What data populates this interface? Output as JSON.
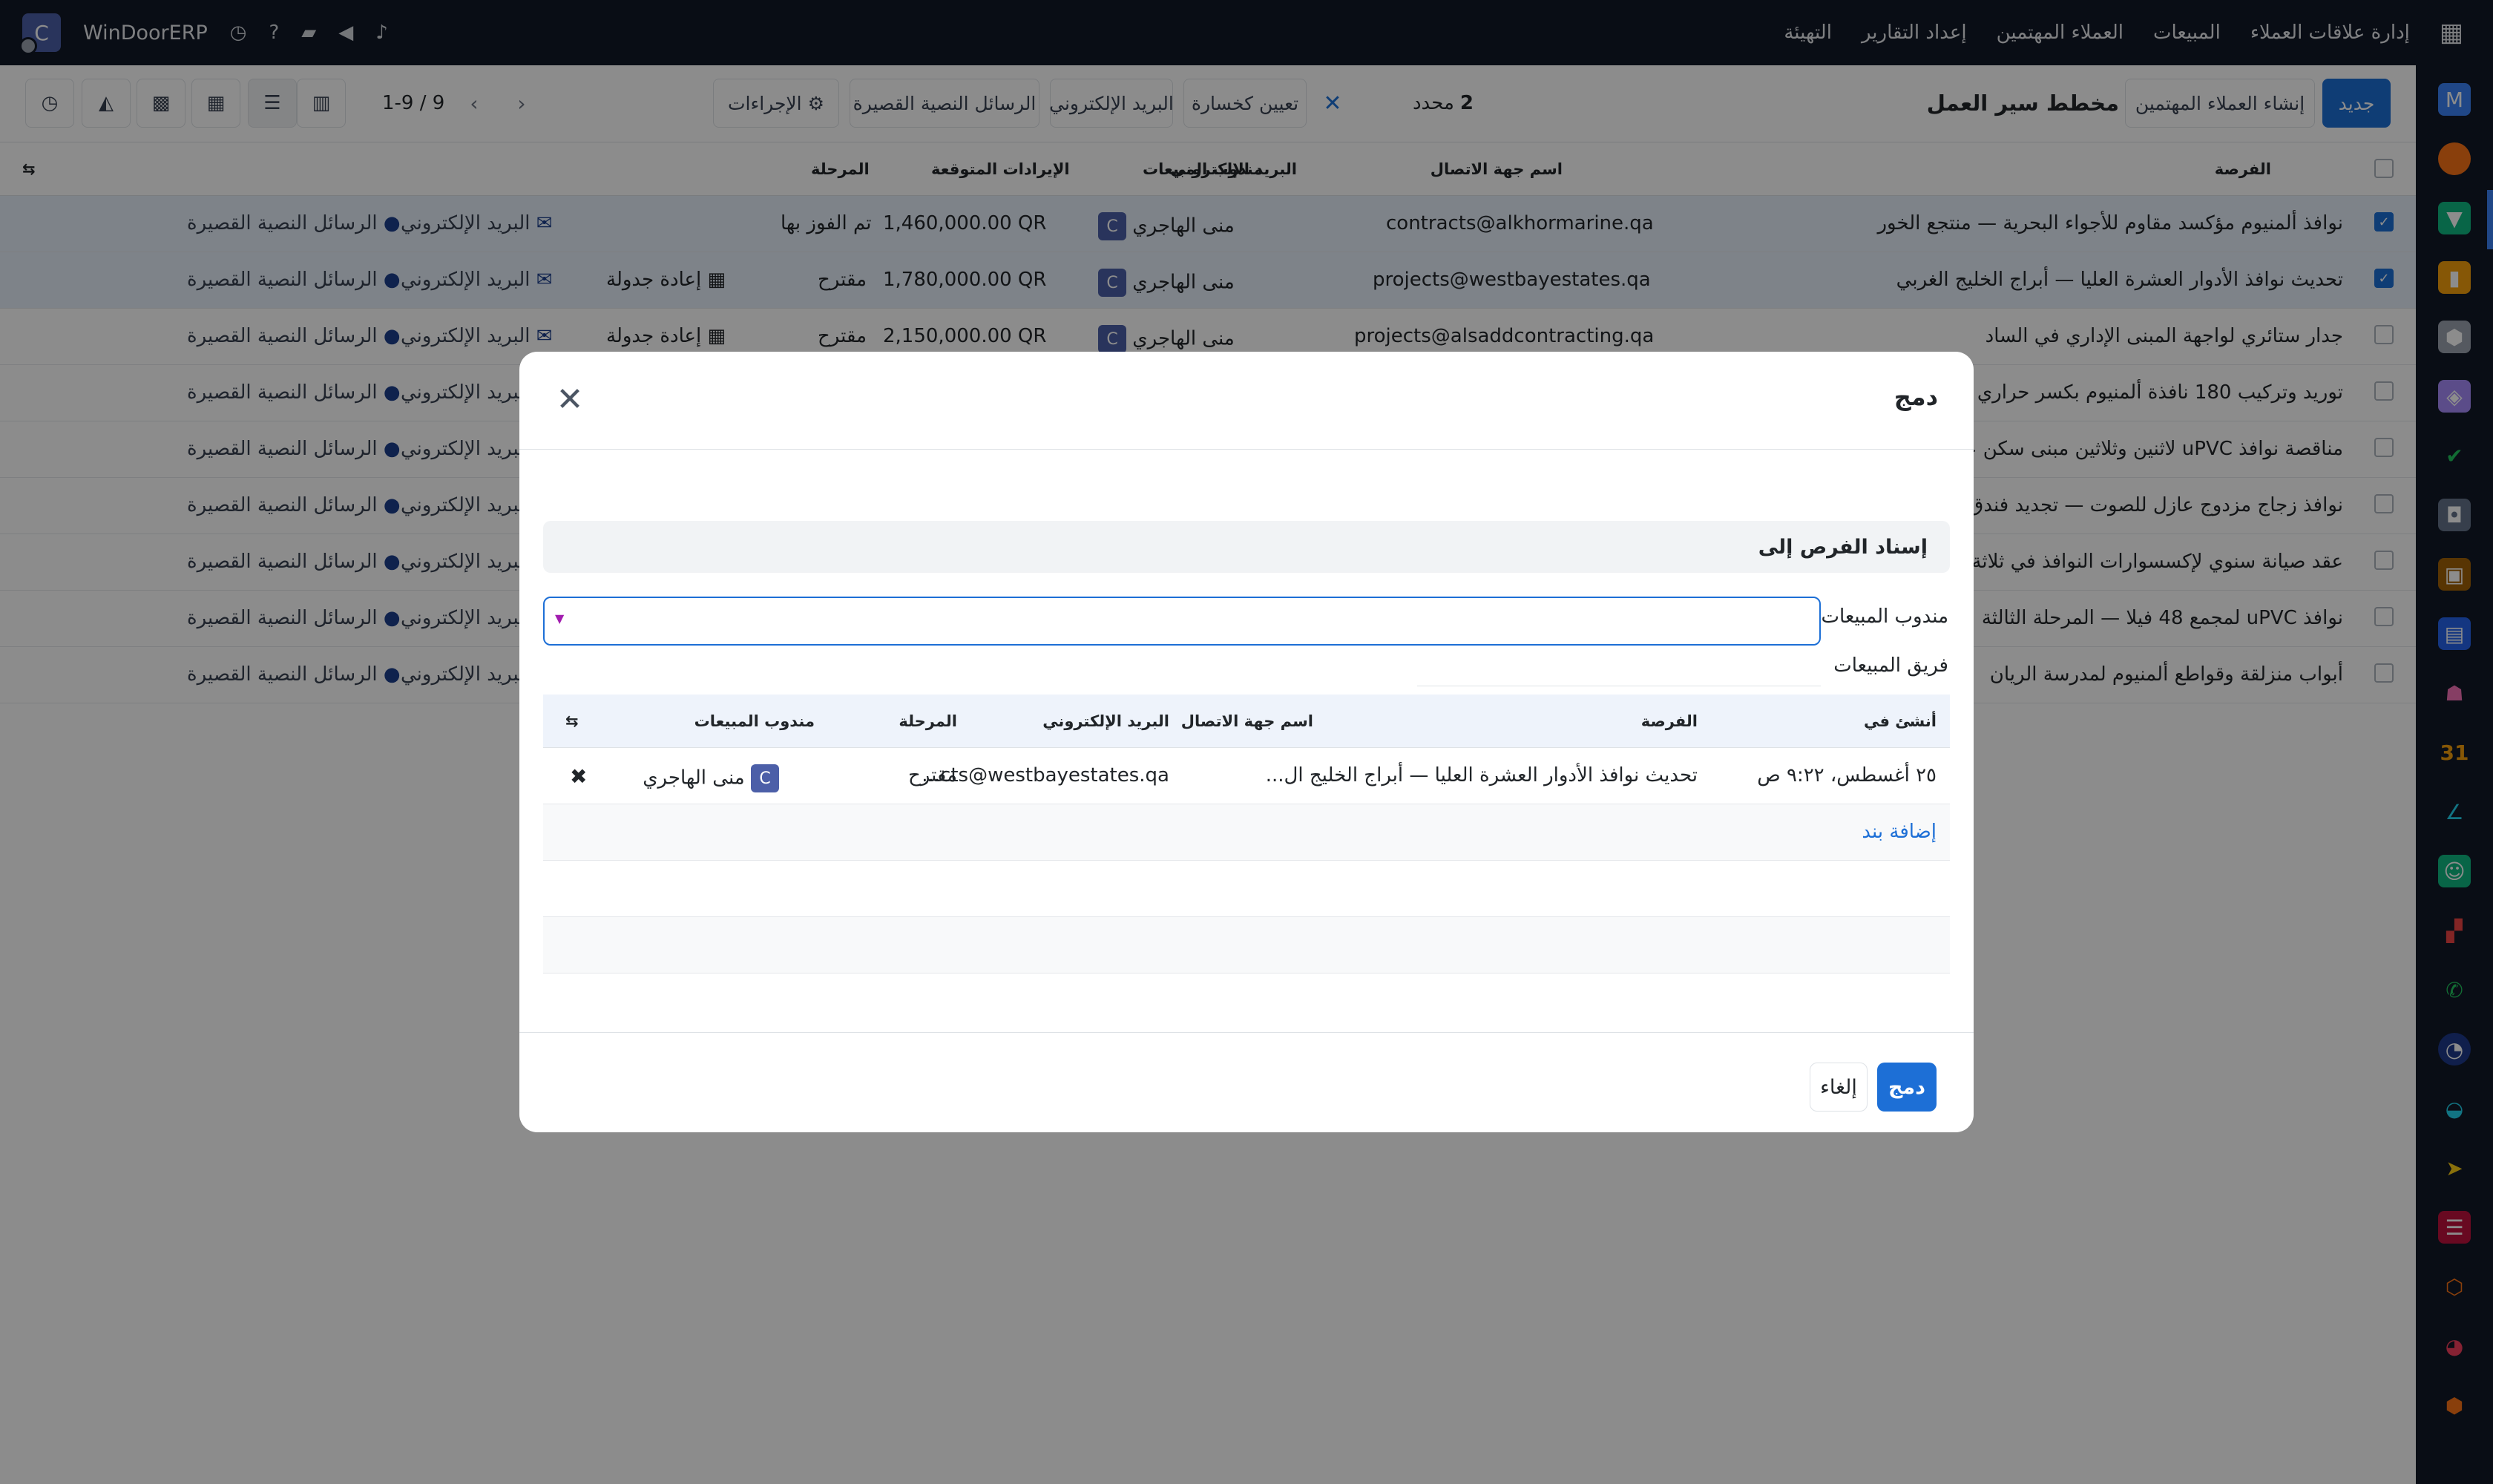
{
  "topbar": {
    "apps_icon": "grid-icon",
    "nav": [
      "إدارة علاقات العملاء",
      "المبيعات",
      "العملاء المهتمين",
      "إعداد التقارير",
      "التهيئة"
    ],
    "brand": "WinDoorERP",
    "avatar_letter": "C"
  },
  "control": {
    "new_label": "جديد",
    "create_leads_label": "إنشاء العملاء المهتمين",
    "title": "مخطط سير العمل",
    "selected_count": "2",
    "selected_label": "محدد",
    "mark_lost_label": "تعيين كخسارة",
    "email_label": "البريد الإلكتروني",
    "sms_label": "الرسائل النصية القصيرة",
    "actions_label": "الإجراءات",
    "pager": "1-9 / 9"
  },
  "list": {
    "headers": {
      "opportunity": "الفرصة",
      "contact": "اسم جهة الاتصال",
      "email": "البريد الإلكتروني",
      "salesperson": "مندوب المبيعات",
      "revenue": "الإيرادات المتوقعة",
      "stage": "المرحلة"
    },
    "action_email": "البريد الإلكتروني",
    "action_sms": "الرسائل النصية القصيرة",
    "reschedule": "إعادة جدولة",
    "rows": [
      {
        "opportunity": "نوافذ ألمنيوم مؤكسد مقاوم للأجواء البحرية — منتجع الخور",
        "email": "contracts@alkhormarine.qa",
        "salesperson": "منى الهاجري",
        "revenue": "1,460,000.00 QR",
        "stage": "تم الفوز بها",
        "reschedule": "",
        "selected": true
      },
      {
        "opportunity": "تحديث نوافذ الأدوار العشرة العليا — أبراج الخليج الغربي",
        "email": "projects@westbayestates.qa",
        "salesperson": "منى الهاجري",
        "revenue": "1,780,000.00 QR",
        "stage": "مقترح",
        "reschedule": "إعادة جدولة",
        "selected": true
      },
      {
        "opportunity": "جدار ستائري لواجهة المبنى الإداري في الساد",
        "email": "projects@alsaddcontracting.qa",
        "salesperson": "منى الهاجري",
        "revenue": "2,150,000.00 QR",
        "stage": "مقترح",
        "reschedule": "إعادة جدولة",
        "selected": false
      },
      {
        "opportunity": "توريد وتركيب 180 نافذة ألمنيوم بكسر حراري — أبراج ما",
        "email": "",
        "salesperson": "",
        "revenue": "",
        "stage": "",
        "reschedule": "",
        "selected": false
      },
      {
        "opportunity": "مناقصة نوافذ uPVC لاثنين وثلاثين مبنى سكن عمال",
        "email": "",
        "salesperson": "",
        "revenue": "",
        "stage": "",
        "reschedule": "",
        "selected": false
      },
      {
        "opportunity": "نوافذ زجاج مزدوج عازل للصوت — تجديد فندق خليج ال",
        "email": "",
        "salesperson": "",
        "revenue": "",
        "stage": "",
        "reschedule": "",
        "selected": false
      },
      {
        "opportunity": "عقد صيانة سنوي لإكسسوارات النوافذ في ثلاثة أبراج",
        "email": "",
        "salesperson": "",
        "revenue": "",
        "stage": "",
        "reschedule": "",
        "selected": false
      },
      {
        "opportunity": "نوافذ uPVC لمجمع 48 فيلا — المرحلة الثالثة",
        "email": "",
        "salesperson": "",
        "revenue": "",
        "stage": "",
        "reschedule": "",
        "selected": false
      },
      {
        "opportunity": "أبواب منزلقة وقواطع ألمنيوم لمدرسة الريان",
        "email": "",
        "salesperson": "",
        "revenue": "",
        "stage": "",
        "reschedule": "",
        "selected": false
      }
    ]
  },
  "modal": {
    "title": "دمج",
    "section_title": "إسناد الفرص إلى",
    "salesperson_label": "مندوب المبيعات",
    "sales_team_label": "فريق المبيعات",
    "table_headers": {
      "created_on": "أنشئ في",
      "opportunity": "الفرصة",
      "contact": "اسم جهة الاتصال",
      "email": "البريد الإلكتروني",
      "stage": "المرحلة",
      "salesperson": "مندوب المبيعات"
    },
    "row": {
      "created_on": "٢٥ أغسطس، ٩:٢٢ ص",
      "opportunity": "تحديث نوافذ الأدوار العشرة العليا — أبراج الخليج ال...",
      "email": "...cts@westbayestates.qa",
      "stage": "مقترح",
      "salesperson": "منى الهاجري",
      "salesperson_badge": "C"
    },
    "add_line": "إضافة بند",
    "merge_button": "دمج",
    "cancel_button": "إلغاء"
  },
  "colors": {
    "primary": "#1d6fd6",
    "topbar": "#111827",
    "badge": "#4c5fa8"
  }
}
